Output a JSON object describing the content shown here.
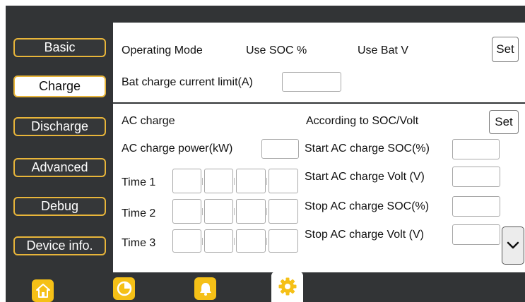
{
  "sidebar": {
    "items": [
      {
        "label": "Basic",
        "active": false
      },
      {
        "label": "Charge",
        "active": true
      },
      {
        "label": "Discharge",
        "active": false
      },
      {
        "label": "Advanced",
        "active": false
      },
      {
        "label": "Debug",
        "active": false
      },
      {
        "label": "Device info.",
        "active": false
      }
    ]
  },
  "operating": {
    "label": "Operating Mode",
    "option_soc": "Use SOC %",
    "option_batv": "Use Bat V",
    "set_label": "Set",
    "bat_charge_limit_label": "Bat charge current limit(A)",
    "bat_charge_limit_value": ""
  },
  "ac_charge": {
    "label": "AC charge",
    "mode_label": "According to SOC/Volt",
    "set_label": "Set",
    "power_label": "AC charge power(kW)",
    "power_value": "",
    "times": [
      {
        "label": "Time  1"
      },
      {
        "label": "Time  2"
      },
      {
        "label": "Time  3"
      }
    ],
    "start_soc_label": "Start AC charge SOC(%)",
    "start_volt_label": "Start AC charge Volt (V)",
    "stop_soc_label": "Stop AC charge SOC(%)",
    "stop_volt_label": "Stop AC charge Volt (V)"
  },
  "nav": {
    "icons": [
      "home-icon",
      "pie-chart-icon",
      "bell-icon",
      "gear-icon"
    ],
    "active": "gear-icon"
  },
  "colors": {
    "background": "#323436",
    "accent": "#e8b53a",
    "nav_icon": "#f5c017"
  }
}
